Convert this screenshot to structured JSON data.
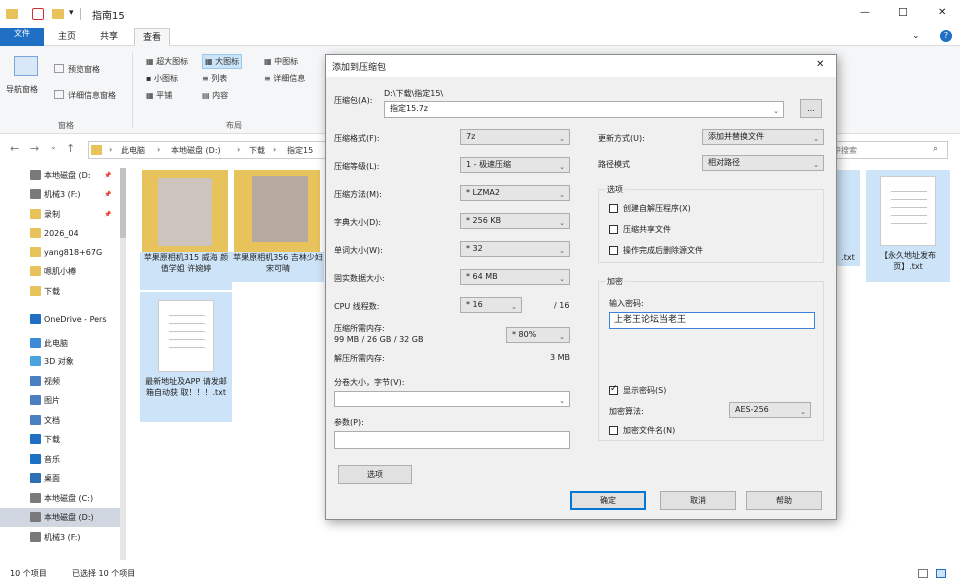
{
  "window": {
    "title": "指南15",
    "minimize": "—",
    "maximize": "☐",
    "close": "✕"
  },
  "qat": {
    "dropdown": "▾"
  },
  "ribbon": {
    "tabs": [
      "文件",
      "主页",
      "共享",
      "查看"
    ],
    "help": "?",
    "collapse": "⌄",
    "nav_pane": "导航窗格",
    "preview_pane": "预览窗格",
    "details_pane": "详细信息窗格",
    "group_pane": "窗格",
    "layouts": [
      "超大图标",
      "大图标",
      "中图标",
      "小图标",
      "列表",
      "详细信息",
      "平铺",
      "内容"
    ],
    "group_layout": "布局"
  },
  "address": {
    "back": "←",
    "forward": "→",
    "up_history": "⌄",
    "up": "↑",
    "chevron": "›",
    "crumbs": [
      "此电脑",
      "本地磁盘 (D:)",
      "下载",
      "指定15"
    ],
    "refresh": "⟳",
    "search_placeholder": "中搜索"
  },
  "sidebar": [
    {
      "label": "本地磁盘 (D:",
      "pin": "📌",
      "color": "#7a7a7a"
    },
    {
      "label": "机械3 (F:)",
      "pin": "📌",
      "color": "#7a7a7a"
    },
    {
      "label": "录制",
      "pin": "📌",
      "color": "#e8c25a"
    },
    {
      "label": "2026_04",
      "pin": "",
      "color": "#e8c25a"
    },
    {
      "label": "yang818+67G",
      "pin": "",
      "color": "#e8c25a"
    },
    {
      "label": "嗯肌小樽",
      "pin": "",
      "color": "#e8c25a"
    },
    {
      "label": "下载",
      "pin": "",
      "color": "#e8c25a"
    },
    {
      "label": "OneDrive - Pers",
      "pin": "",
      "color": "#1f6fc5"
    },
    {
      "label": "此电脑",
      "pin": "",
      "color": "#3d8ad9"
    },
    {
      "label": "3D 对象",
      "pin": "",
      "color": "#4aa3df"
    },
    {
      "label": "视频",
      "pin": "",
      "color": "#4a7fc1"
    },
    {
      "label": "图片",
      "pin": "",
      "color": "#4a7fc1"
    },
    {
      "label": "文档",
      "pin": "",
      "color": "#4a7fc1"
    },
    {
      "label": "下载",
      "pin": "",
      "color": "#1f6fc5"
    },
    {
      "label": "音乐",
      "pin": "",
      "color": "#1f6fc5"
    },
    {
      "label": "桌面",
      "pin": "",
      "color": "#2d6fb5"
    },
    {
      "label": "本地磁盘 (C:)",
      "pin": "",
      "color": "#7a7a7a"
    },
    {
      "label": "本地磁盘 (D:)",
      "pin": "",
      "color": "#7a7a7a"
    },
    {
      "label": "机械3 (F:)",
      "pin": "",
      "color": "#7a7a7a"
    }
  ],
  "files": [
    {
      "name": "苹果原相机315 威海 颜值学姐 许婉婷"
    },
    {
      "name": "苹果原相机356 吉林少妇 宋可晴"
    },
    {
      "name": "最新地址及APP 请发邮箱自动获 取！！！.txt"
    },
    {
      "name": ".txt"
    },
    {
      "name": "【永久地址发布 页】.txt"
    }
  ],
  "status": {
    "count": "10 个项目",
    "selected": "已选择 10 个项目"
  },
  "dialog": {
    "title": "添加到压缩包",
    "close": "✕",
    "archive_label": "压缩包(A):",
    "archive_path": "D:\\下载\\指定15\\",
    "archive_name": "指定15.7z",
    "browse": "...",
    "format_label": "压缩格式(F):",
    "format": "7z",
    "level_label": "压缩等级(L):",
    "level": "1 - 极速压缩",
    "method_label": "压缩方法(M):",
    "method": "* LZMA2",
    "dict_label": "字典大小(D):",
    "dict": "* 256 KB",
    "word_label": "单词大小(W):",
    "word": "* 32",
    "solid_label": "固实数据大小:",
    "solid": "* 64 MB",
    "cpu_label": "CPU 线程数:",
    "cpu": "* 16",
    "cpu_total": "/ 16",
    "mem_label": "压缩所需内存:",
    "mem_value": "99 MB / 26 GB / 32 GB",
    "mem_pct": "* 80%",
    "decomp_label": "解压所需内存:",
    "decomp_value": "3 MB",
    "split_label": "分卷大小，字节(V):",
    "params_label": "参数(P):",
    "options_btn": "选项",
    "update_label": "更新方式(U):",
    "update": "添加并替换文件",
    "path_label": "路径模式",
    "path": "相对路径",
    "options_group": "选项",
    "sfx": "创建自解压程序(X)",
    "shared": "压缩共享文件",
    "delete": "操作完成后删除源文件",
    "enc_group": "加密",
    "pwd_label": "输入密码:",
    "pwd": "上老王论坛当老王",
    "show_pwd": "显示密码(S)",
    "enc_method_label": "加密算法:",
    "enc_method": "AES-256",
    "enc_names": "加密文件名(N)",
    "ok": "确定",
    "cancel": "取消",
    "help": "帮助",
    "caret": "⌄"
  }
}
